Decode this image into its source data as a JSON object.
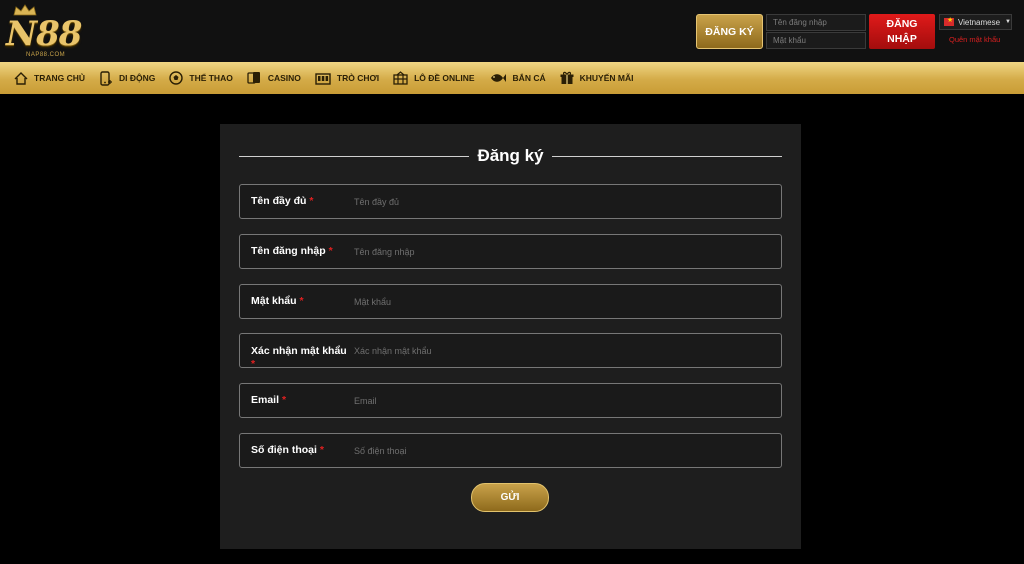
{
  "header": {
    "logo_text": "N88",
    "logo_domain": "NAP88.COM",
    "register_label": "ĐĂNG KÝ",
    "username_placeholder": "Tên đăng nhập",
    "password_placeholder": "Mật khẩu",
    "login_label_line1": "ĐĂNG",
    "login_label_line2": "NHẬP",
    "language": "Vietnamese",
    "forgot_password": "Quên mật khẩu"
  },
  "nav": {
    "items": [
      {
        "label": "TRANG CHỦ",
        "icon": "home-icon"
      },
      {
        "label": "DI ĐỘNG",
        "icon": "mobile-icon"
      },
      {
        "label": "THỂ THAO",
        "icon": "soccer-ball-icon"
      },
      {
        "label": "CASINO",
        "icon": "cards-icon"
      },
      {
        "label": "TRÒ CHƠI",
        "icon": "slot-machine-icon"
      },
      {
        "label": "LÔ ĐỀ ONLINE",
        "icon": "lottery-icon"
      },
      {
        "label": "BẮN CÁ",
        "icon": "fish-icon"
      },
      {
        "label": "KHUYẾN MÃI",
        "icon": "gift-icon"
      }
    ]
  },
  "form": {
    "title": "Đăng ký",
    "fields": [
      {
        "label": "Tên đầy đủ",
        "placeholder": "Tên đầy đủ"
      },
      {
        "label": "Tên đăng nhập",
        "placeholder": "Tên đăng nhập"
      },
      {
        "label": "Mật khẩu",
        "placeholder": "Mật khẩu"
      },
      {
        "label": "Xác nhận mật khẩu",
        "placeholder": "Xác nhận mật khẩu"
      },
      {
        "label": "Email",
        "placeholder": "Email"
      },
      {
        "label": "Số điện thoại",
        "placeholder": "Số điện thoại"
      }
    ],
    "required_mark": "*",
    "submit_label": "GỬI"
  },
  "colors": {
    "gold": "#d4ab48",
    "red": "#e01a1a",
    "card_bg": "#1e1e1e"
  }
}
